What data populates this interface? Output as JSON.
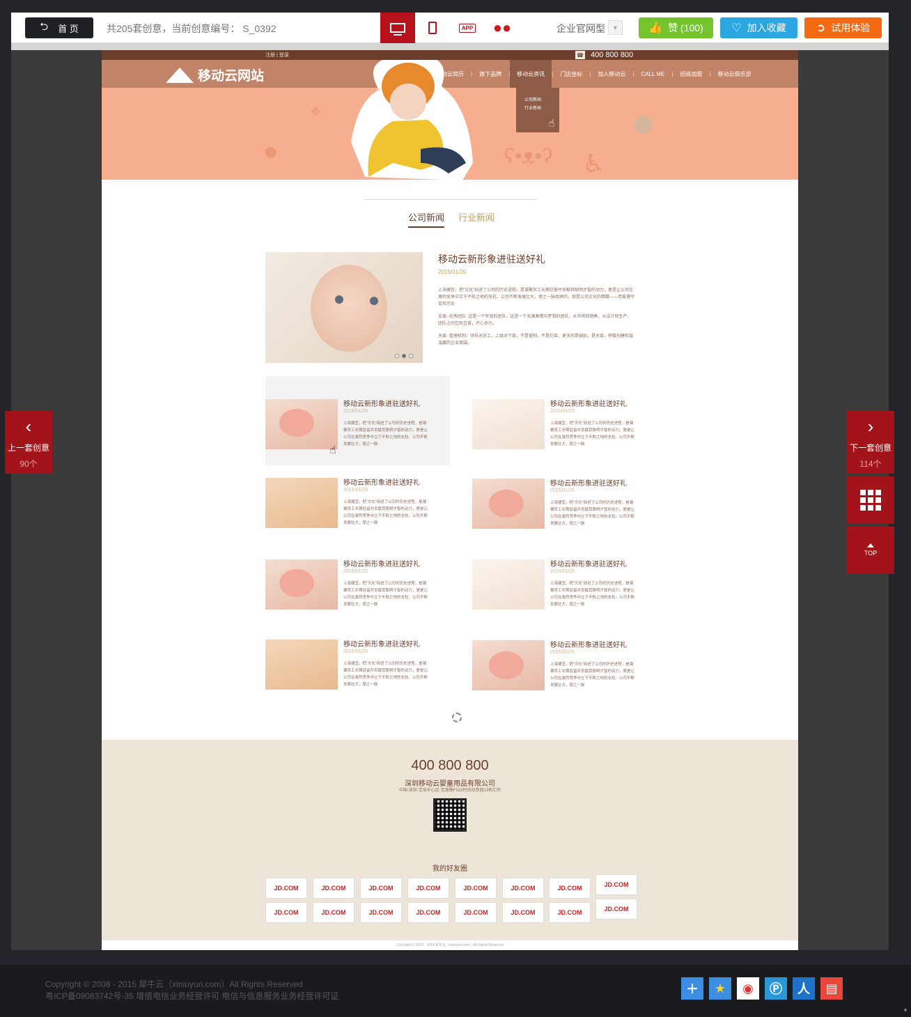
{
  "topbar": {
    "home_label": "首 页",
    "info_text": "共205套创意，当前创意编号： S_0392",
    "devices": [
      "desktop",
      "tablet",
      "app",
      "wechat"
    ],
    "app_label": "APP",
    "type_label": "企业官网型",
    "like_label": "赞 (100)",
    "fav_label": "加入收藏",
    "try_label": "试用体验"
  },
  "site": {
    "login_text": "注册 | 登录",
    "phone": "400 800 800",
    "logo_text": "移动云网站",
    "nav": [
      "移动云简历",
      "旗下品牌",
      "移动云资讯",
      "门店坐标",
      "加入移动云",
      "CALL ME",
      "招商加盟",
      "移动云俱乐部"
    ],
    "dropdown": [
      "公司新闻",
      "行业新闻"
    ],
    "tabs": [
      "公司新闻",
      "行业新闻"
    ],
    "feature": {
      "title": "移动云新形象进驻送好礼",
      "date": "2015/01/25",
      "paragraphs": [
        "上海捷宜，把“文化”刻进了公司的历史进程，是凝聚员工长期驻留并贡献其聪明才智的动力，更是让公司在激烈竞争中立于不败之地的支柱。公司不断发展壮大，使之一脉相承的，就是公司文化的精髓——用爱遵写百年历史",
        "友爱--优秀团队: 这是一个年轻的团队，这是一个充满激情与梦想的团队，从市场到销售，从设计到生产，团队之间互助互爱，齐心协力。",
        "关爱--管理机制：领导对员工，上级对下级，不是管制，不是约束，更多的是鼓励，是关爱，积极创建和谐温馨的企业氛围。"
      ]
    },
    "card_title": "移动云新形象进驻送好礼",
    "card_date": "2015/01/25",
    "card_body": "上海捷宜，把“文化”刻进了公司的历史进程，是凝聚员工长期驻留并贡献其聪明才智的动力，更是让公司在激烈竞争中立于不败之地的支柱。公司不断发展壮大，使之一脉",
    "footer": {
      "phone": "400 800 800",
      "company": "深圳移动云婴童用品有限公司",
      "address": "中国·深圳·宝安中心区·宝源路F518时尚创意园13栋汇所",
      "friends_title": "我的好友圈",
      "logo_label": "JD.COM",
      "copyright": "Copyright © 2008 - 2014 犀牛云（xiniuyun.com）All Rights Reserved"
    }
  },
  "side": {
    "prev_label": "上一套创意",
    "prev_count": "90个",
    "next_label": "下一套创意",
    "next_count": "114个",
    "top_label": "TOP"
  },
  "pagefoot": {
    "line1": "Copyright © 2008 - 2015 犀牛云（xiniuyun.com）All Rights Reserved",
    "line2": "粤ICP备09063742号-35 增值电信业务经营许可 电信与信息服务业务经营许可证",
    "shares": [
      "plus-share",
      "qzone",
      "weibo",
      "tencent-weibo",
      "renren",
      "evernote"
    ]
  },
  "colors": {
    "accent": "#b5121b",
    "like": "#74c52d",
    "fav": "#2ca6e0",
    "try": "#f46a12",
    "brown": "#6b3e2b",
    "banner": "#f6ae8f"
  }
}
